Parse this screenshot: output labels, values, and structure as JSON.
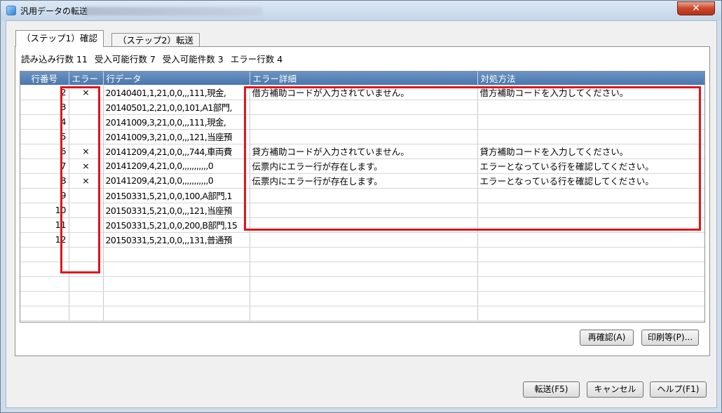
{
  "window": {
    "title": "汎用データの転送",
    "close_label": "✕"
  },
  "tabs": [
    {
      "label": "（ステップ1）確認",
      "active": true
    },
    {
      "label": "（ステップ2）転送",
      "active": false
    }
  ],
  "summary": {
    "read_rows": "読み込み行数 11",
    "acceptable_rows": "受入可能行数 7",
    "acceptable_count": "受入可能件数 3",
    "error_rows": "エラー行数 4"
  },
  "grid": {
    "columns": [
      "行番号",
      "エラー",
      "行データ",
      "エラー詳細",
      "対処方法"
    ],
    "rows": [
      {
        "num": "2",
        "err": "×",
        "data": "20140401,1,21,0,0,,,111,現金,",
        "detail": "借方補助コードが入力されていません。",
        "action": "借方補助コードを入力してください。"
      },
      {
        "num": "3",
        "err": "",
        "data": "20140501,2,21,0,0,101,A1部門,",
        "detail": "",
        "action": ""
      },
      {
        "num": "4",
        "err": "",
        "data": "20141009,3,21,0,0,,,111,現金,",
        "detail": "",
        "action": ""
      },
      {
        "num": "5",
        "err": "",
        "data": "20141009,3,21,0,0,,,121,当座預",
        "detail": "",
        "action": ""
      },
      {
        "num": "6",
        "err": "×",
        "data": "20141209,4,21,0,0,,,744,車両費",
        "detail": "貸方補助コードが入力されていません。",
        "action": "貸方補助コードを入力してください。"
      },
      {
        "num": "7",
        "err": "×",
        "data": "20141209,4,21,0,0,,,,,,,,,,,0",
        "detail": "伝票内にエラー行が存在します。",
        "action": "エラーとなっている行を確認してください。"
      },
      {
        "num": "8",
        "err": "×",
        "data": "20141209,4,21,0,0,,,,,,,,,,,0",
        "detail": "伝票内にエラー行が存在します。",
        "action": "エラーとなっている行を確認してください。"
      },
      {
        "num": "9",
        "err": "",
        "data": "20150331,5,21,0,0,100,A部門,1",
        "detail": "",
        "action": ""
      },
      {
        "num": "10",
        "err": "",
        "data": "20150331,5,21,0,0,,,121,当座預",
        "detail": "",
        "action": ""
      },
      {
        "num": "11",
        "err": "",
        "data": "20150331,5,21,0,0,200,B部門,15",
        "detail": "",
        "action": ""
      },
      {
        "num": "12",
        "err": "",
        "data": "20150331,5,21,0,0,,,131,普通預",
        "detail": "",
        "action": ""
      }
    ],
    "empty_rows": 5
  },
  "buttons": {
    "recheck": "再確認(A)",
    "print": "印刷等(P)...",
    "transfer": "転送(F5)",
    "cancel": "キャンセル",
    "help": "ヘルプ(F1)"
  },
  "colors": {
    "header_blue": "#5a84b8",
    "highlight_red": "#e1141c"
  }
}
